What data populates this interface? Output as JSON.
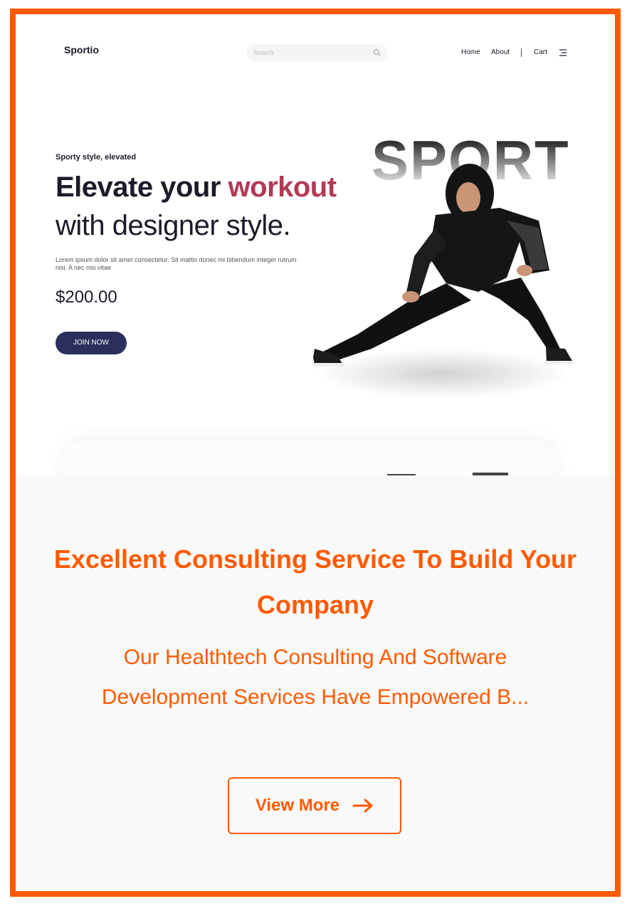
{
  "colors": {
    "frame": "#FF5A00",
    "accent_text": "#B23A56",
    "button_dark": "#2B2F5C",
    "overlay_bg": "#f9f9f9"
  },
  "header": {
    "brand": "Sportio",
    "search_placeholder": "Search",
    "nav": {
      "home": "Home",
      "about": "About",
      "cart": "Cart"
    },
    "icons": [
      "search-icon",
      "menu-icon"
    ]
  },
  "hero": {
    "eyebrow": "Sporty style, elevated",
    "headline_part1": "Elevate your",
    "headline_accent": "workout",
    "headline_line2": "with designer style.",
    "body": "Lorem ipsum dolor sit amet consectetur. Sit mattis donec mi bibendum integer rutrum nisi. A nec nisi vitae",
    "price": "$200.00",
    "cta": "JOIN NOW",
    "bg_word": "SPORT"
  },
  "overlay": {
    "title": "Excellent Consulting Service To Build Your Company",
    "subtitle": "Our Healthtech Consulting And Software Development Services Have Empowered B...",
    "button_label": "View More",
    "button_icon": "arrow-right-icon"
  }
}
